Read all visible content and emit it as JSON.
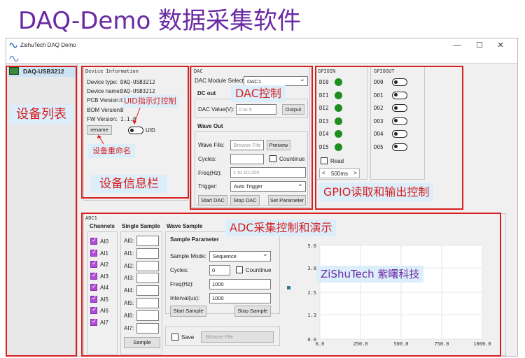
{
  "page_title": "DAQ-Demo 数据采集软件",
  "window": {
    "title": "ZishuTech DAQ Demo",
    "minimize": "—",
    "maximize": "☐",
    "close": "✕"
  },
  "sidebar": {
    "device": "DAQ-USB3212"
  },
  "device_info": {
    "title": "Device Information",
    "type_label": "Device type:",
    "type_value": "DAQ-USB3212",
    "name_label": "Device name:",
    "name_value": "DAQ-USB3212",
    "pcb_label": "PCB Version:",
    "pcb_value": "0",
    "bom_label": "BOM Version:",
    "bom_value": "0",
    "fw_label": "FW Version:",
    "fw_value": "1.1.0",
    "rename": "rename",
    "uid": "UID"
  },
  "dac": {
    "title": "DAC",
    "module_label": "DAC Module Select:",
    "module_value": "DAC1",
    "dc_out": "DC out",
    "value_label": "DAC Value(V):",
    "value_placeholder": "0 to 5",
    "output": "Output",
    "wave_out": "Wave Out",
    "wave_file_label": "Wave File:",
    "browse": "Browse File",
    "preview": "Preivew",
    "cycles_label": "Cycles:",
    "countinue": "Countinue",
    "freq_label": "Freq(Hz):",
    "freq_placeholder": "1 to 10,000",
    "trigger_label": "Trigger:",
    "trigger_value": "Auto Trigger",
    "start": "Start DAC",
    "stop": "Stop DAC",
    "set": "Set Parameter"
  },
  "gpio": {
    "in_title": "GPIOIN",
    "out_title": "GPIOOUT",
    "inputs": [
      "DI0",
      "DI1",
      "DI2",
      "DI3",
      "DI4",
      "DI5"
    ],
    "outputs": [
      "DO0",
      "DO1",
      "DO2",
      "DO3",
      "DO4",
      "DO5"
    ],
    "read": "Read",
    "prev": "<",
    "interval": "500ms",
    "next": ">"
  },
  "adc": {
    "title": "ADC1",
    "channels_title": "Channels",
    "single_title": "Single Sample",
    "wave_title": "Wave Sample",
    "channels": [
      "AI0",
      "AI1",
      "AI2",
      "AI3",
      "AI4",
      "AI5",
      "AI6",
      "AI7"
    ],
    "single_labels": [
      "AI0:",
      "AI1:",
      "AI2:",
      "AI3:",
      "AI4:",
      "AI5:",
      "AI6:",
      "AI7:"
    ],
    "sample": "Sample",
    "param_title": "Sample Parameter",
    "mode_label": "Sample Mode:",
    "mode_value": "Sequence",
    "cycles_label": "Cycles:",
    "cycles_value": "0",
    "countinue": "Countinue",
    "freq_label": "Freq(Hz):",
    "freq_value": "1000",
    "interval_label": "Interval(us):",
    "interval_value": "1000",
    "start": "Start Sample",
    "stop": "Stop Sample",
    "save": "Save",
    "browse": "Browse File"
  },
  "chart_data": {
    "type": "line",
    "y_ticks": [
      "5.0",
      "3.8",
      "2.5",
      "1.3",
      "0.0"
    ],
    "x_ticks": [
      "0.0",
      "250.0",
      "500.0",
      "750.0",
      "1000.0"
    ],
    "xlim": [
      0,
      1000
    ],
    "ylim": [
      0,
      5
    ],
    "series": []
  },
  "annotations": {
    "device_list": "设备列表",
    "uid_led": "UID指示灯控制",
    "rename": "设备重命名",
    "device_info": "设备信息栏",
    "dac": "DAC控制",
    "gpio": "GPIO读取和输出控制",
    "adc": "ADC采集控制和演示",
    "watermark": "ZiShuTech 紫曙科技"
  }
}
